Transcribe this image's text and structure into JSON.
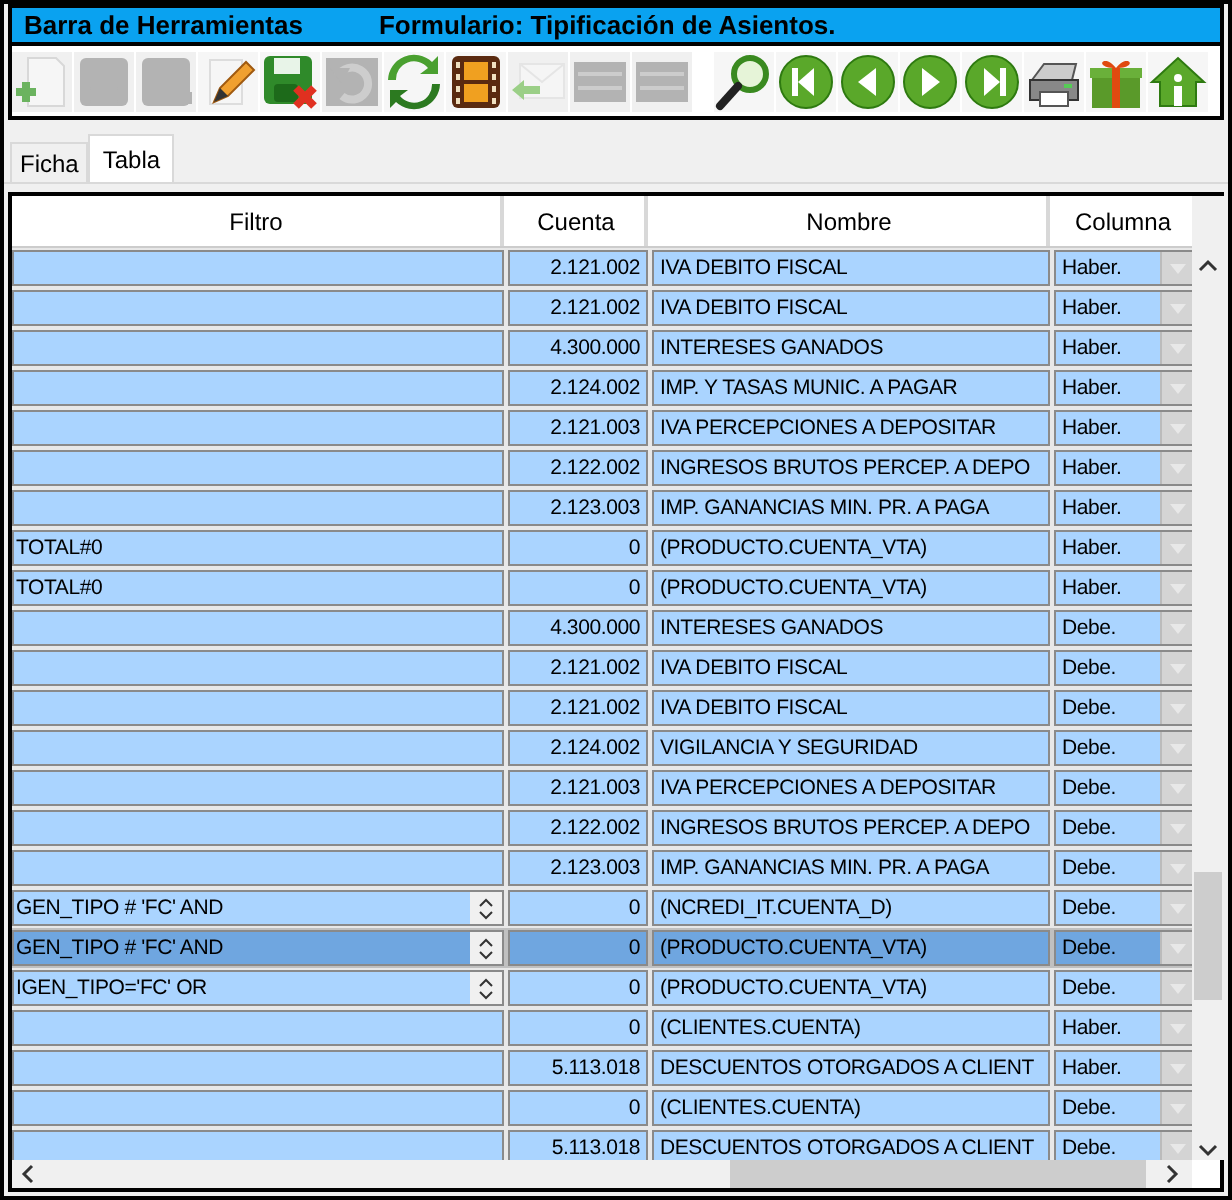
{
  "title_bar": {
    "toolbar_title": "Barra de Herramientas",
    "form_title": "Formulario: Tipificación de Asientos."
  },
  "toolbar": [
    {
      "kind": "new",
      "disabled": true
    },
    {
      "kind": "save",
      "disabled": true
    },
    {
      "kind": "save-as",
      "disabled": true
    },
    {
      "kind": "edit",
      "disabled": false
    },
    {
      "kind": "cancel-save",
      "disabled": false
    },
    {
      "kind": "undo",
      "disabled": true
    },
    {
      "kind": "refresh",
      "disabled": false
    },
    {
      "kind": "film",
      "disabled": false
    },
    {
      "kind": "reply",
      "disabled": true
    },
    {
      "kind": "list-add",
      "disabled": true
    },
    {
      "kind": "list-remove",
      "disabled": true
    },
    {
      "kind": "search",
      "disabled": false
    },
    {
      "kind": "first",
      "disabled": false
    },
    {
      "kind": "prev",
      "disabled": false
    },
    {
      "kind": "next",
      "disabled": false
    },
    {
      "kind": "last",
      "disabled": false
    },
    {
      "kind": "print",
      "disabled": false
    },
    {
      "kind": "gift",
      "disabled": false
    },
    {
      "kind": "home",
      "disabled": false
    }
  ],
  "tabs": [
    {
      "label": "Ficha",
      "selected": false
    },
    {
      "label": "Tabla",
      "selected": true
    }
  ],
  "table": {
    "columns": [
      "Filtro",
      "Cuenta",
      "Nombre",
      "Columna"
    ],
    "rows": [
      {
        "filtro": "",
        "cuenta": "2.121.002",
        "nombre": "IVA DEBITO FISCAL",
        "columna": "Haber.",
        "spinner": false,
        "selected": false
      },
      {
        "filtro": "",
        "cuenta": "2.121.002",
        "nombre": "IVA DEBITO FISCAL",
        "columna": "Haber.",
        "spinner": false,
        "selected": false
      },
      {
        "filtro": "",
        "cuenta": "4.300.000",
        "nombre": "INTERESES GANADOS",
        "columna": "Haber.",
        "spinner": false,
        "selected": false
      },
      {
        "filtro": "",
        "cuenta": "2.124.002",
        "nombre": "IMP. Y TASAS MUNIC. A PAGAR",
        "columna": "Haber.",
        "spinner": false,
        "selected": false
      },
      {
        "filtro": "",
        "cuenta": "2.121.003",
        "nombre": "IVA PERCEPCIONES A DEPOSITAR",
        "columna": "Haber.",
        "spinner": false,
        "selected": false
      },
      {
        "filtro": "",
        "cuenta": "2.122.002",
        "nombre": "INGRESOS BRUTOS PERCEP. A DEPO",
        "columna": "Haber.",
        "spinner": false,
        "selected": false
      },
      {
        "filtro": "",
        "cuenta": "2.123.003",
        "nombre": "IMP. GANANCIAS MIN. PR. A PAGA",
        "columna": "Haber.",
        "spinner": false,
        "selected": false
      },
      {
        "filtro": "TOTAL#0",
        "cuenta": "0",
        "nombre": "(PRODUCTO.CUENTA_VTA)",
        "columna": "Haber.",
        "spinner": false,
        "selected": false
      },
      {
        "filtro": "TOTAL#0",
        "cuenta": "0",
        "nombre": "(PRODUCTO.CUENTA_VTA)",
        "columna": "Haber.",
        "spinner": false,
        "selected": false
      },
      {
        "filtro": "",
        "cuenta": "4.300.000",
        "nombre": "INTERESES GANADOS",
        "columna": "Debe.",
        "spinner": false,
        "selected": false
      },
      {
        "filtro": "",
        "cuenta": "2.121.002",
        "nombre": "IVA DEBITO FISCAL",
        "columna": "Debe.",
        "spinner": false,
        "selected": false
      },
      {
        "filtro": "",
        "cuenta": "2.121.002",
        "nombre": "IVA DEBITO FISCAL",
        "columna": "Debe.",
        "spinner": false,
        "selected": false
      },
      {
        "filtro": "",
        "cuenta": "2.124.002",
        "nombre": "VIGILANCIA Y SEGURIDAD",
        "columna": "Debe.",
        "spinner": false,
        "selected": false
      },
      {
        "filtro": "",
        "cuenta": "2.121.003",
        "nombre": "IVA PERCEPCIONES A DEPOSITAR",
        "columna": "Debe.",
        "spinner": false,
        "selected": false
      },
      {
        "filtro": "",
        "cuenta": "2.122.002",
        "nombre": "INGRESOS BRUTOS PERCEP. A DEPO",
        "columna": "Debe.",
        "spinner": false,
        "selected": false
      },
      {
        "filtro": "",
        "cuenta": "2.123.003",
        "nombre": "IMP. GANANCIAS MIN. PR. A PAGA",
        "columna": "Debe.",
        "spinner": false,
        "selected": false
      },
      {
        "filtro": "GEN_TIPO # 'FC' AND",
        "cuenta": "0",
        "nombre": "(NCREDI_IT.CUENTA_D)",
        "columna": "Debe.",
        "spinner": true,
        "selected": false
      },
      {
        "filtro": "GEN_TIPO # 'FC' AND",
        "cuenta": "0",
        "nombre": "(PRODUCTO.CUENTA_VTA)",
        "columna": "Debe.",
        "spinner": true,
        "selected": true
      },
      {
        "filtro": "IGEN_TIPO='FC' OR",
        "cuenta": "0",
        "nombre": "(PRODUCTO.CUENTA_VTA)",
        "columna": "Debe.",
        "spinner": true,
        "selected": false
      },
      {
        "filtro": "",
        "cuenta": "0",
        "nombre": "(CLIENTES.CUENTA)",
        "columna": "Haber.",
        "spinner": false,
        "selected": false
      },
      {
        "filtro": "",
        "cuenta": "5.113.018",
        "nombre": "DESCUENTOS OTORGADOS A CLIENT",
        "columna": "Haber.",
        "spinner": false,
        "selected": false
      },
      {
        "filtro": "",
        "cuenta": "0",
        "nombre": "(CLIENTES.CUENTA)",
        "columna": "Debe.",
        "spinner": false,
        "selected": false
      },
      {
        "filtro": "",
        "cuenta": "5.113.018",
        "nombre": "DESCUENTOS OTORGADOS A CLIENT",
        "columna": "Debe.",
        "spinner": false,
        "selected": false
      }
    ]
  }
}
